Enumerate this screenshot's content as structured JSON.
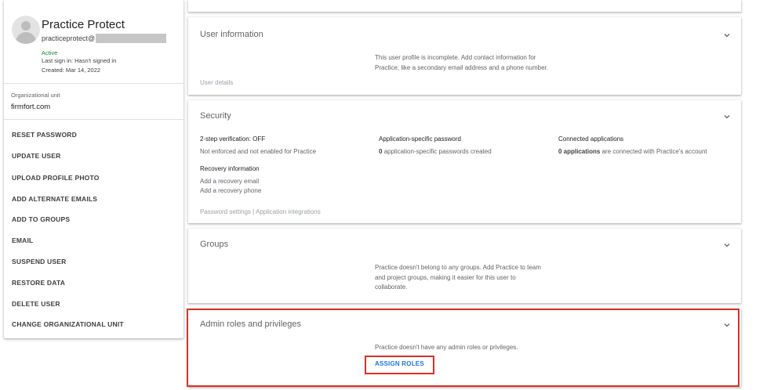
{
  "user": {
    "name": "Practice Protect",
    "email_prefix": "practiceprotect@",
    "status": "Active",
    "last_sign_in": "Last sign in: Hasn't signed in",
    "created": "Created: Mar 14, 2022"
  },
  "org_unit": {
    "label": "Organizational unit",
    "value": "firmfort.com"
  },
  "actions": [
    "RESET PASSWORD",
    "UPDATE USER",
    "UPLOAD PROFILE PHOTO",
    "ADD ALTERNATE EMAILS",
    "ADD TO GROUPS",
    "EMAIL",
    "SUSPEND USER",
    "RESTORE DATA",
    "DELETE USER",
    "CHANGE ORGANIZATIONAL UNIT"
  ],
  "user_information": {
    "title": "User information",
    "desc_line1": "This user profile is incomplete. Add contact information for",
    "desc_line2": "Practice, like a secondary email address and a phone number.",
    "footer": "User details"
  },
  "security": {
    "title": "Security",
    "two_step_heading": "2-step verification: OFF",
    "two_step_sub": "Not enforced and not enabled for Practice",
    "app_password_heading": "Application-specific password",
    "app_password_count": "0",
    "app_password_sub": "application-specific passwords created",
    "connected_heading": "Connected applications",
    "connected_count": "0 applications",
    "connected_sub": "are connected with Practice's account",
    "recovery_heading": "Recovery information",
    "recovery_email": "Add a recovery email",
    "recovery_phone": "Add a recovery phone",
    "footer": "Password settings | Application integrations"
  },
  "groups": {
    "title": "Groups",
    "desc_line1": "Practice doesn't belong to any groups. Add Practice to team",
    "desc_line2": "and project groups, making it easier for this user to",
    "desc_line3": "collaborate."
  },
  "admin_roles": {
    "title": "Admin roles and privileges",
    "desc": "Practice doesn't have any admin roles or privileges.",
    "button": "ASSIGN ROLES"
  },
  "colors": {
    "highlight": "#d93025",
    "link": "#1a73e8",
    "active": "#188038"
  }
}
